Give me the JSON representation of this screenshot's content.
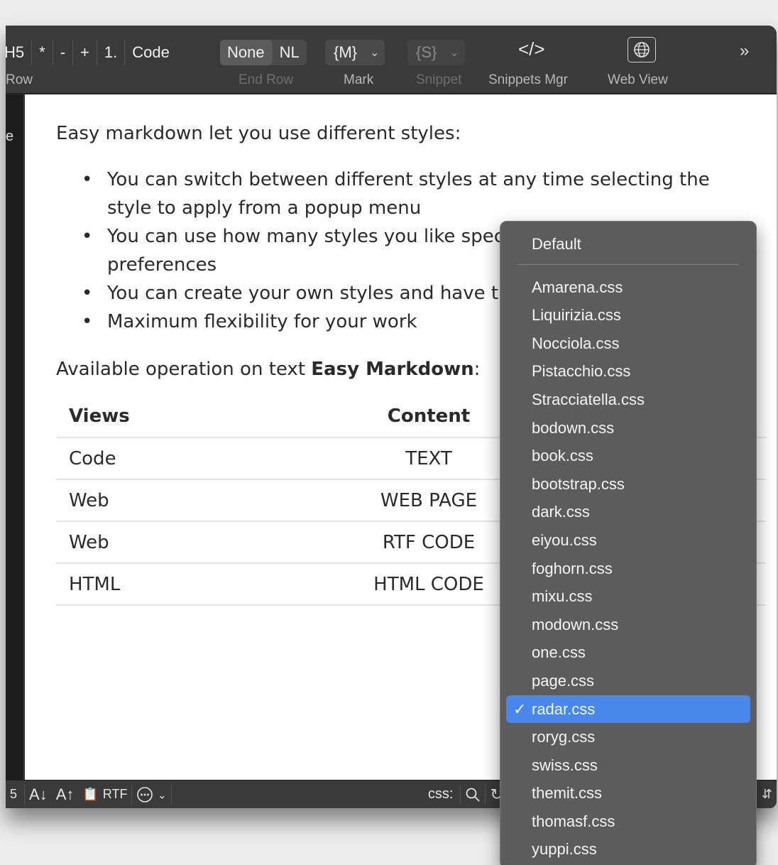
{
  "toolbar": {
    "format_segments": [
      "H5",
      "*",
      "-",
      "+",
      "1.",
      "Code"
    ],
    "row_label": "Row",
    "end_row": {
      "options": [
        "None",
        "NL"
      ],
      "label": "End Row"
    },
    "mark": {
      "value": "{M}",
      "label": "Mark"
    },
    "snippet": {
      "value": "{S}",
      "label": "Snippet"
    },
    "snippets_mgr": {
      "icon": "</>",
      "label": "Snippets Mgr"
    },
    "web_view": {
      "label": "Web View"
    },
    "more": "»"
  },
  "left_strip_char": "e",
  "document": {
    "intro": "Easy markdown let you use different styles:",
    "bullets": [
      "You can switch between different styles at any time selecting the style to apply from a popup menu",
      "You can use how many styles you like spec",
      "You can create your own styles and have th",
      "Maximum flexibility for your work"
    ],
    "bullet2_cont": "preferences",
    "operation_prefix": "Available operation on text ",
    "operation_bold": "Easy Markdown",
    "operation_suffix": ":",
    "table": {
      "headers": [
        "Views",
        "Content"
      ],
      "rows": [
        [
          "Code",
          "TEXT"
        ],
        [
          "Web",
          "WEB PAGE"
        ],
        [
          "Web",
          "RTF CODE"
        ],
        [
          "HTML",
          "HTML CODE"
        ]
      ]
    }
  },
  "statusbar": {
    "left_num": "5",
    "sort_down": "A↓",
    "sort_up": "A↑",
    "rtf": "RTF",
    "css_label": "css:"
  },
  "menu": {
    "default": "Default",
    "items": [
      "Amarena.css",
      "Liquirizia.css",
      "Nocciola.css",
      "Pistacchio.css",
      "Stracciatella.css",
      "bodown.css",
      "book.css",
      "bootstrap.css",
      "dark.css",
      "eiyou.css",
      "foghorn.css",
      "mixu.css",
      "modown.css",
      "one.css",
      "page.css",
      "radar.css",
      "roryg.css",
      "swiss.css",
      "themit.css",
      "thomasf.css",
      "yuppi.css"
    ],
    "selected": "radar.css",
    "check": "✓"
  },
  "colors": {
    "accent": "#4a87ea",
    "toolbar": "#3a3a3a",
    "menu": "#5c5c5c"
  }
}
